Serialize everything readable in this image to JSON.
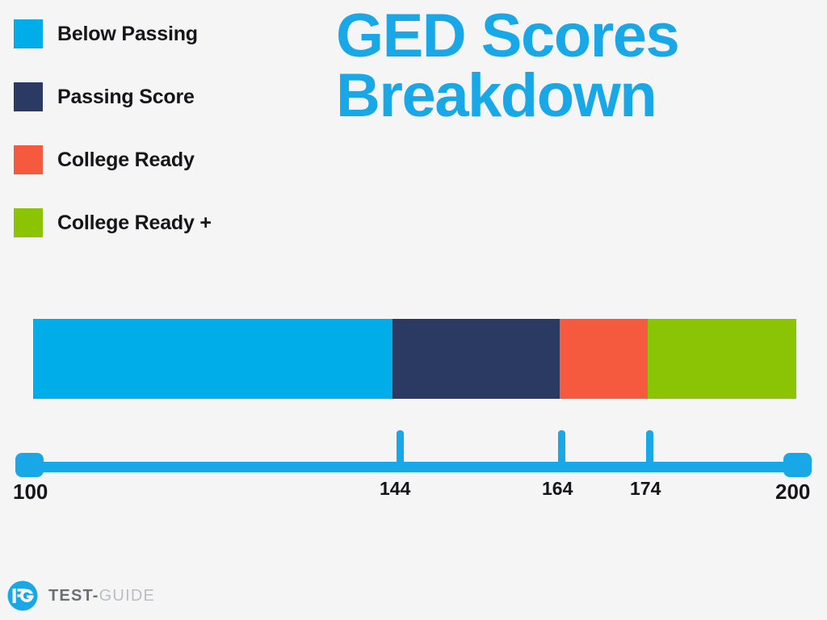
{
  "background_color": "#f5f5f6",
  "title": {
    "line1": "GED Scores",
    "line2": "Breakdown",
    "color": "#18a8e8"
  },
  "legend": {
    "items": [
      {
        "label": "Below Passing",
        "color": "#00ade8"
      },
      {
        "label": "Passing Score",
        "color": "#2a3a63"
      },
      {
        "label": "College Ready",
        "color": "#f55a3e"
      },
      {
        "label": "College Ready +",
        "color": "#8bc404"
      }
    ]
  },
  "footer": {
    "logo_icon": "test-guide-logo-icon",
    "brand_primary": "TEST-",
    "brand_secondary": "GUIDE"
  },
  "chart_data": {
    "type": "bar",
    "orientation": "horizontal-stacked",
    "title": "GED Scores Breakdown",
    "xlabel": "",
    "ylabel": "",
    "xlim": [
      100,
      200
    ],
    "grid": false,
    "legend_position": "top-left",
    "axis_ticks": [
      100,
      144,
      164,
      174,
      200
    ],
    "axis_tick_labels": [
      "100",
      "144",
      "164",
      "174",
      "200"
    ],
    "endpoint_ticks": [
      100,
      200
    ],
    "categories": [
      "Below Passing",
      "Passing Score",
      "College Ready",
      "College Ready +"
    ],
    "segments": [
      {
        "name": "Below Passing",
        "start": 100,
        "end": 144,
        "span": 44,
        "color": "#00ade8"
      },
      {
        "name": "Passing Score",
        "start": 144,
        "end": 164,
        "span": 20,
        "color": "#2a3a63"
      },
      {
        "name": "College Ready",
        "start": 164,
        "end": 174,
        "span": 10,
        "color": "#f55a3e"
      },
      {
        "name": "College Ready +",
        "start": 174,
        "end": 200,
        "span": 26,
        "color": "#8bc404"
      }
    ],
    "values": [
      44,
      20,
      10,
      26
    ]
  },
  "axis_colors": {
    "track": "#18a8e8",
    "tick": "#18a8e8",
    "handle": "#18a8e8"
  }
}
